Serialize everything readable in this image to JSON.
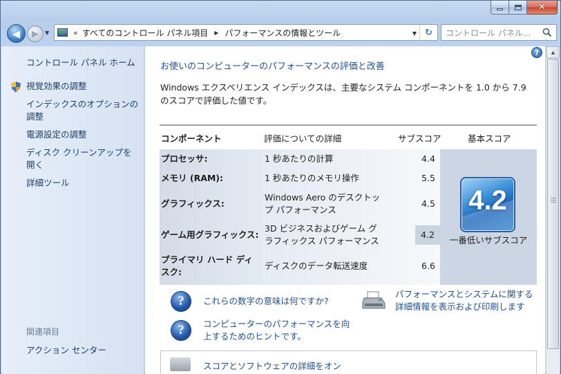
{
  "window": {
    "caption_buttons": {
      "minimize": "minimize",
      "maximize": "maximize",
      "close": "✕"
    }
  },
  "nav": {
    "back": "◀",
    "forward": "▶",
    "history": "▼",
    "overflow": "«",
    "breadcrumbs": [
      "すべてのコントロール パネル項目",
      "パフォーマンスの情報とツール"
    ],
    "crumb_separator": "▶",
    "address_dropdown": "▼",
    "refresh": "↻",
    "search_placeholder": "コントロール パネル..."
  },
  "sidebar": {
    "home": "コントロール パネル ホーム",
    "tasks": [
      "視覚効果の調整",
      "インデックスのオプションの調整",
      "電源設定の調整",
      "ディスク クリーンアップを開く",
      "詳細ツール"
    ],
    "related_heading": "関連項目",
    "related": [
      "アクション センター"
    ]
  },
  "main": {
    "help": "?",
    "title": "お使いのコンピューターのパフォーマンスの評価と改善",
    "description": "Windows エクスペリエンス インデックスは、主要なシステム コンポーネントを 1.0 から 7.9 のスコアで評価した値です。",
    "table": {
      "headers": {
        "component": "コンポーネント",
        "details": "評価についての詳細",
        "subscore": "サブスコア",
        "basescore": "基本スコア"
      },
      "rows": [
        {
          "component": "プロセッサ:",
          "detail": "1 秒あたりの計算",
          "subscore": "4.4"
        },
        {
          "component": "メモリ (RAM):",
          "detail": "1 秒あたりのメモリ操作",
          "subscore": "5.5"
        },
        {
          "component": "グラフィックス:",
          "detail": "Windows Aero のデスクトップ パフォーマンス",
          "subscore": "4.5"
        },
        {
          "component": "ゲーム用グラフィックス:",
          "detail": "3D ビジネスおよびゲーム グラフィックス パフォーマンス",
          "subscore": "4.2"
        },
        {
          "component": "プライマリ ハード ディスク:",
          "detail": "ディスクのデータ転送速度",
          "subscore": "6.6"
        }
      ],
      "base_score": "4.2",
      "base_label": "一番低いサブスコア"
    },
    "links": {
      "what_numbers_mean": "これらの数字の意味は何ですか?",
      "tips": "コンピューターのパフォーマンスを向上するためのヒントです。",
      "print_details": "パフォーマンスとシステムに関する詳細情報を表示および印刷します",
      "bottom": "スコアとソフトウェアの詳細をオン"
    },
    "help_icon": "?"
  },
  "scrollbar": {
    "up": "▲"
  },
  "colors": {
    "link": "#1f4f8f",
    "sidebar_link": "#1f3d64",
    "badge": "#1c63b7",
    "lowest_score_bg": "#c9d4e1"
  }
}
